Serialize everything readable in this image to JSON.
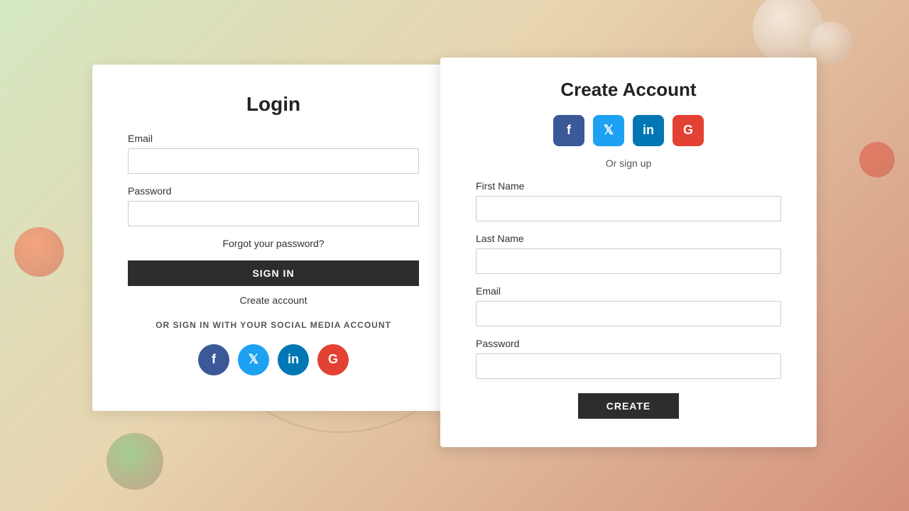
{
  "background": {
    "color_start": "#d4e8c2",
    "color_mid": "#e8d5b0",
    "color_end": "#d4907a"
  },
  "login": {
    "title": "Login",
    "email_label": "Email",
    "email_placeholder": "",
    "password_label": "Password",
    "password_placeholder": "",
    "forgot_password_text": "Forgot your password?",
    "sign_in_button": "SIGN IN",
    "create_account_link": "Create account",
    "social_divider": "OR SIGN IN WITH YOUR SOCIAL MEDIA ACCOUNT",
    "social_buttons": [
      {
        "id": "facebook",
        "label": "f",
        "class": "facebook"
      },
      {
        "id": "twitter",
        "label": "t",
        "class": "twitter"
      },
      {
        "id": "linkedin",
        "label": "in",
        "class": "linkedin"
      },
      {
        "id": "google",
        "label": "G",
        "class": "google"
      }
    ]
  },
  "create": {
    "title": "Create Account",
    "social_buttons": [
      {
        "id": "facebook",
        "label": "f",
        "class": "facebook"
      },
      {
        "id": "twitter",
        "label": "t",
        "class": "twitter"
      },
      {
        "id": "linkedin",
        "label": "in",
        "class": "linkedin"
      },
      {
        "id": "google",
        "label": "G",
        "class": "google"
      }
    ],
    "or_signup_text": "Or sign up",
    "first_name_label": "First Name",
    "first_name_placeholder": "",
    "last_name_label": "Last Name",
    "last_name_placeholder": "",
    "email_label": "Email",
    "email_placeholder": "",
    "password_label": "Password",
    "password_placeholder": "",
    "create_button": "CREATE"
  }
}
